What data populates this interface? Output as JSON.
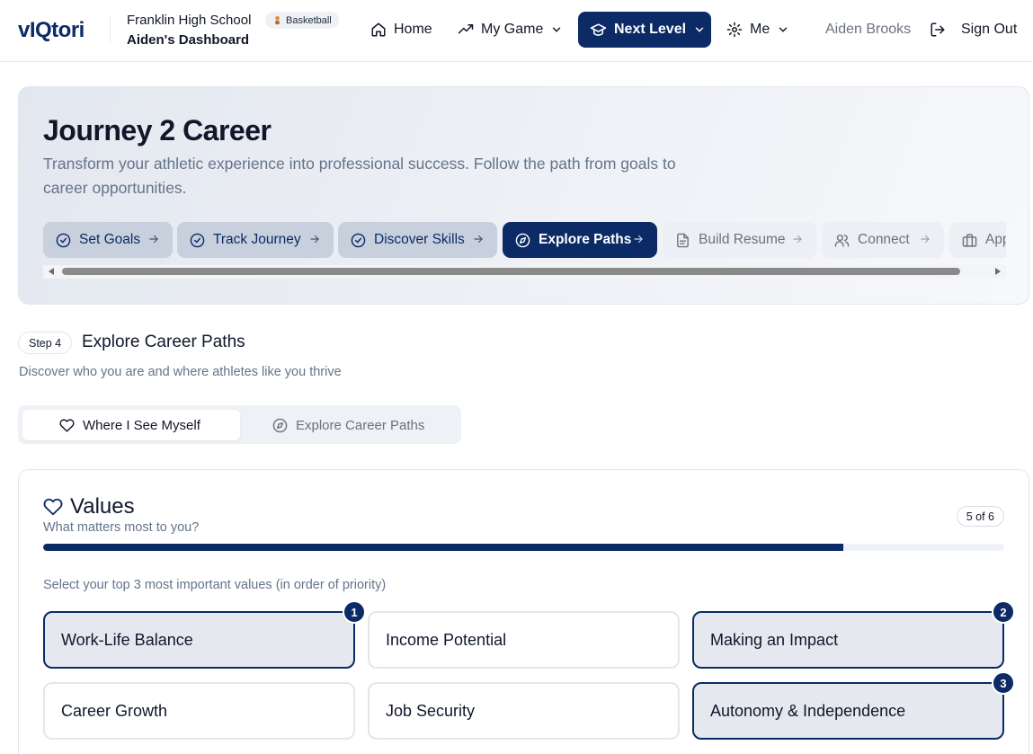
{
  "header": {
    "logo": "vIQtori",
    "school": "Franklin High School",
    "sport_badge": "Basketball",
    "dashboard": "Aiden's Dashboard",
    "nav": {
      "home": "Home",
      "my_game": "My Game",
      "next_level": "Next Level",
      "me": "Me"
    },
    "user_name": "Aiden Brooks",
    "sign_out": "Sign Out"
  },
  "hero": {
    "title": "Journey 2 Career",
    "subtitle": "Transform your athletic experience into professional success. Follow the path from goals to career opportunities.",
    "steps": [
      {
        "label": "Set Goals",
        "state": "done"
      },
      {
        "label": "Track Journey",
        "state": "done"
      },
      {
        "label": "Discover Skills",
        "state": "done"
      },
      {
        "label": "Explore Paths",
        "state": "active"
      },
      {
        "label": "Build Resume",
        "state": "todo"
      },
      {
        "label": "Connect",
        "state": "todo"
      },
      {
        "label": "Apply",
        "state": "todo"
      }
    ]
  },
  "section": {
    "step_pill": "Step 4",
    "title": "Explore Career Paths",
    "subtitle": "Discover who you are and where athletes like you thrive",
    "tabs": [
      "Where I See Myself",
      "Explore Career Paths"
    ]
  },
  "values_card": {
    "title": "Values",
    "subtitle": "What matters most to you?",
    "count": "5 of 6",
    "progress_fraction": 0.833,
    "instruction": "Select your top 3 most important values (in order of priority)",
    "options": [
      {
        "label": "Work-Life Balance",
        "rank": "1"
      },
      {
        "label": "Income Potential",
        "rank": ""
      },
      {
        "label": "Making an Impact",
        "rank": "2"
      },
      {
        "label": "Career Growth",
        "rank": ""
      },
      {
        "label": "Job Security",
        "rank": ""
      },
      {
        "label": "Autonomy & Independence",
        "rank": "3"
      }
    ]
  },
  "colors": {
    "brand_navy": "#0b2a66",
    "muted_text": "#64748b",
    "completed_step": "#c9d0dd"
  }
}
